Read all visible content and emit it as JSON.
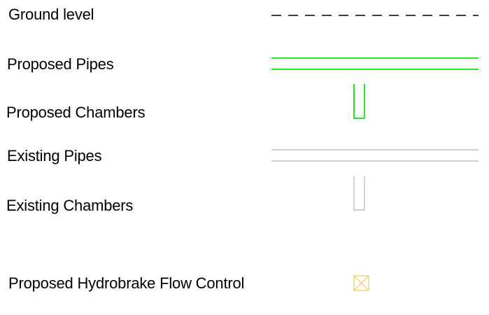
{
  "legend": {
    "items": [
      {
        "label": "Ground level",
        "symbol": "dashed-line",
        "color": "#000000"
      },
      {
        "label": "Proposed Pipes",
        "symbol": "double-line",
        "color": "#22e822"
      },
      {
        "label": "Proposed Chambers",
        "symbol": "u-chamber",
        "color": "#22e822"
      },
      {
        "label": "Existing Pipes",
        "symbol": "double-line",
        "color": "#b4b4b4"
      },
      {
        "label": "Existing Chambers",
        "symbol": "u-chamber",
        "color": "#b4b4b4"
      },
      {
        "label": "Proposed Hydrobrake Flow Control",
        "symbol": "crossed-box",
        "color": "#f0d070"
      }
    ]
  }
}
